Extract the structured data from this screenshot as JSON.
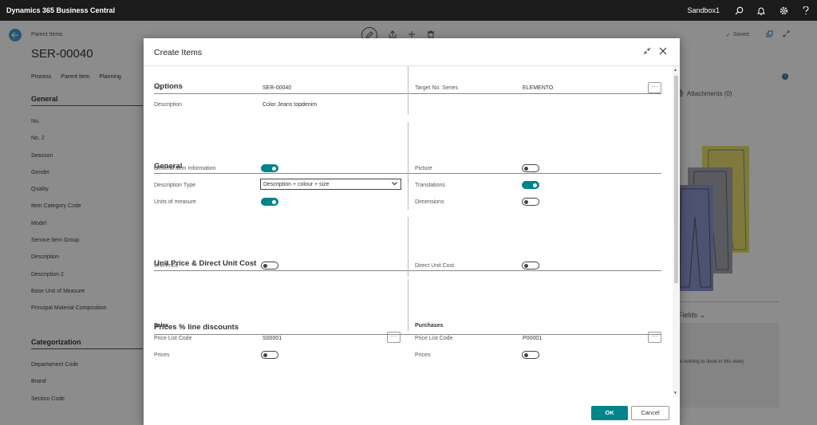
{
  "topbar": {
    "app_title": "Dynamics 365 Business Central",
    "environment": "Sandbox1"
  },
  "page": {
    "breadcrumb": "Parent Items",
    "title": "SER-00040",
    "actions": [
      "Process",
      "Parent Item",
      "Planning"
    ],
    "saved_label": "Saved",
    "general_header": "General",
    "general_fields": [
      "No.",
      "No. 2",
      "Seasson",
      "Gender",
      "Quality",
      "Item Category Code",
      "Model",
      "Service Item Group",
      "Description",
      "Description 2",
      "Base Unit of Measure",
      "Principal Material Composition"
    ],
    "categorization_header": "Categorization",
    "categorization_fields": [
      "Departament Code",
      "Brand",
      "Section Code"
    ],
    "attachments_label": "Attachments (0)",
    "fields_label": "Fields",
    "nothing_text": "e nothing to show in this view)"
  },
  "dialog": {
    "title": "Create Items",
    "options": {
      "header": "Options",
      "no_label": "No.",
      "no_value": "SER-00040",
      "description_label": "Description",
      "description_value": "Color Jeans topdenim",
      "target_label": "Target No. Series",
      "target_value": "ELEMENTO"
    },
    "general": {
      "header": "General",
      "general_item_info": "General Item Information",
      "description_type_label": "Description Type",
      "description_type_value": "Description + colour + size",
      "units_of_measure": "Units of measure",
      "picture": "Picture",
      "translations": "Translations",
      "dimensions": "Dimensions"
    },
    "unit_price": {
      "header": "Unit Price & Direct Unit Cost",
      "unit_price_label": "Unit Price",
      "direct_unit_cost_label": "Direct Unit Cost"
    },
    "prices": {
      "header": "Prices % line discounts",
      "sales_label": "Sales",
      "purchases_label": "Purchases",
      "price_list_code_label": "Price List Code",
      "sales_code": "S00001",
      "purchases_code": "P00001",
      "prices_label": "Prices"
    },
    "ok_label": "OK",
    "cancel_label": "Cancel",
    "dots": "···"
  },
  "toggles": {
    "general_item_information": true,
    "units_of_measure": true,
    "picture": false,
    "translations": true,
    "dimensions": false,
    "unit_price": false,
    "direct_unit_cost": false,
    "sales_prices": false,
    "purchases_prices": false
  },
  "colors": {
    "accent": "#008489",
    "topbar": "#1b1b1b"
  },
  "icons": [
    "back-arrow-icon",
    "search-icon",
    "bell-icon",
    "gear-icon",
    "help-icon",
    "edit-icon",
    "share-icon",
    "plus-icon",
    "delete-icon",
    "collapse-icon",
    "close-icon",
    "check-icon",
    "chevron-down-icon",
    "paperclip-icon",
    "info-icon"
  ]
}
